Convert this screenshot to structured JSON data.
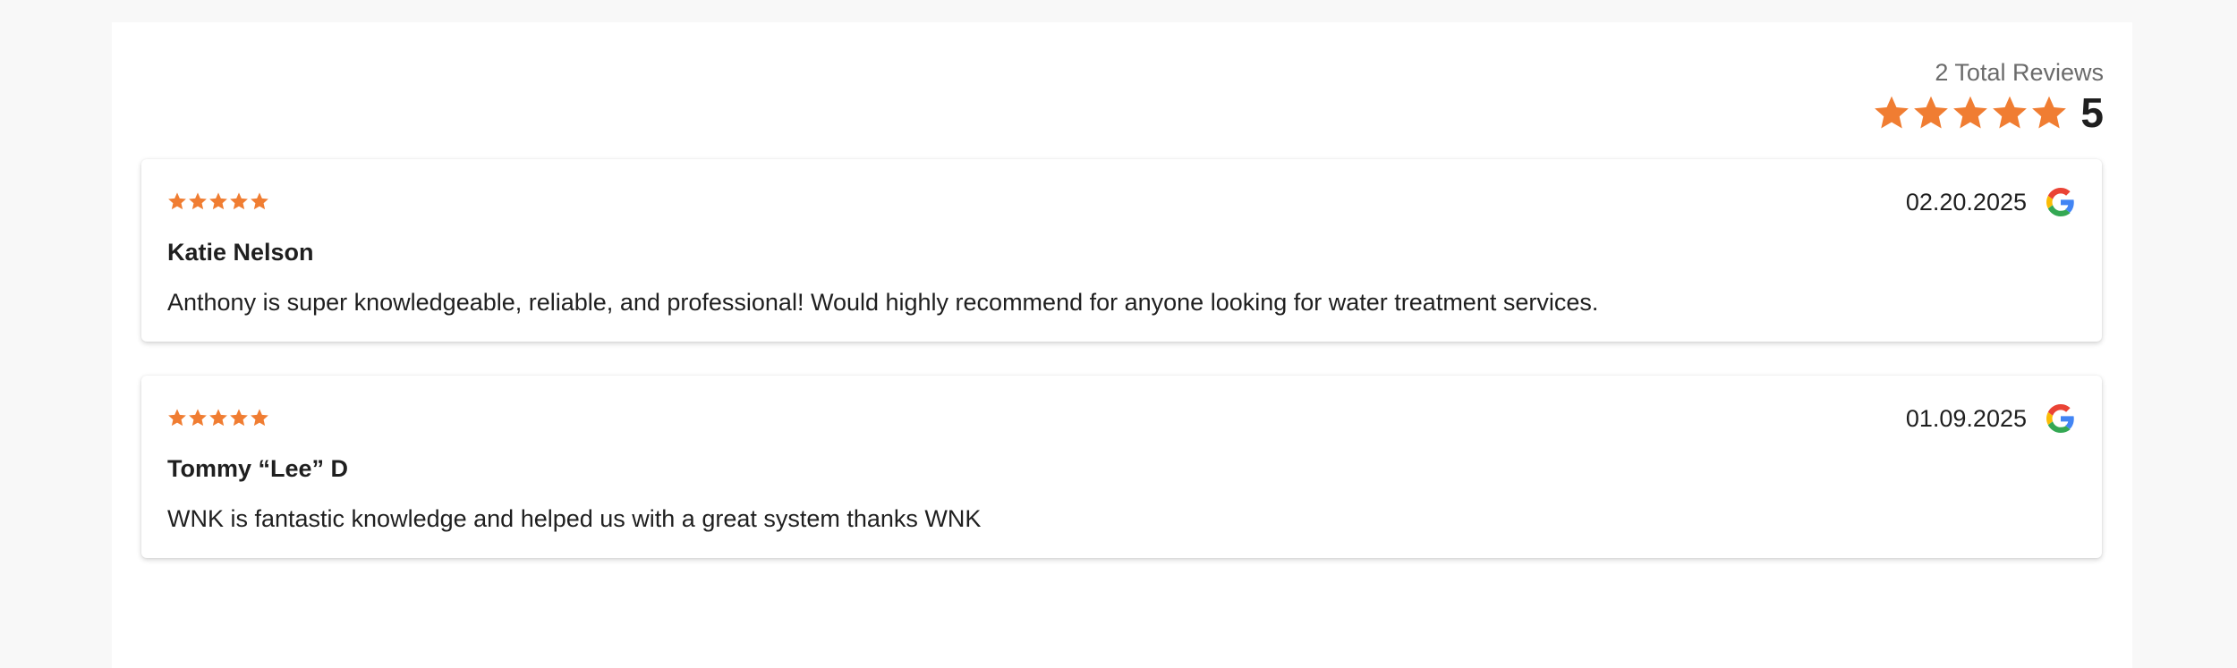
{
  "summary": {
    "total_reviews_label": "2 Total Reviews",
    "average_rating": "5",
    "star_count": 5
  },
  "colors": {
    "star": "#f07d32",
    "google_blue": "#4285F4",
    "google_red": "#EA4335",
    "google_yellow": "#FBBC05",
    "google_green": "#34A853"
  },
  "reviews": [
    {
      "rating": 5,
      "date": "02.20.2025",
      "source_icon": "google-icon",
      "name": "Katie Nelson",
      "text": "Anthony is super knowledgeable, reliable, and professional! Would highly recommend for anyone looking for water treatment services."
    },
    {
      "rating": 5,
      "date": "01.09.2025",
      "source_icon": "google-icon",
      "name": "Tommy “Lee” D",
      "text": "WNK is fantastic knowledge and helped us with a great system thanks WNK"
    }
  ]
}
